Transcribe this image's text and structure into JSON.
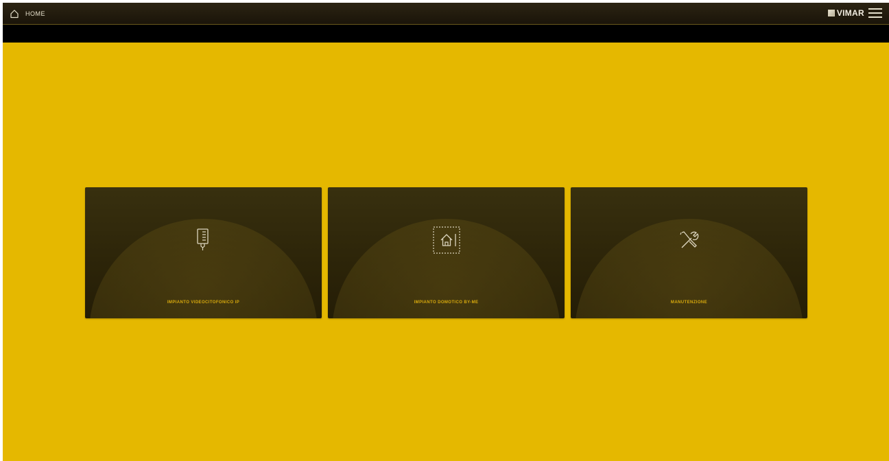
{
  "header": {
    "home_label": "HOME",
    "home_icon": "home-icon",
    "brand": "VIMAR",
    "menu_icon": "hamburger-menu-icon"
  },
  "colors": {
    "background": "#e5b800",
    "topbar": "#221b0c",
    "tile": "#2d2509",
    "tile_label": "#d9aa0e"
  },
  "tiles": [
    {
      "label": "IMPIANTO VIDEOCITOFONICO IP",
      "icon": "door-entry-panel-icon"
    },
    {
      "label": "IMPIANTO DOMOTICO BY-ME",
      "icon": "home-automation-icon"
    },
    {
      "label": "MANUTENZIONE",
      "icon": "tools-icon"
    }
  ]
}
